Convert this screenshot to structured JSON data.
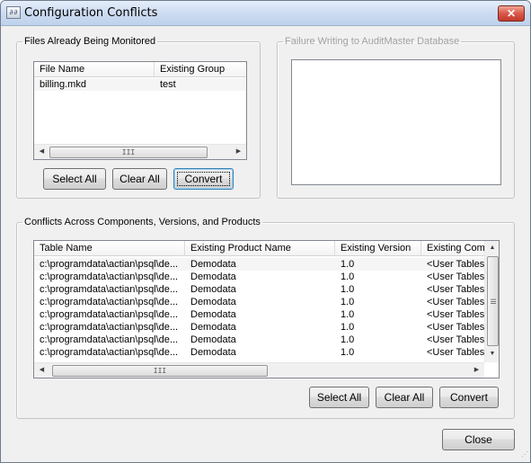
{
  "window": {
    "title": "Configuration Conflicts",
    "icon_text": "∂∂",
    "close_glyph": "✕"
  },
  "monitored": {
    "legend": "Files Already Being Monitored",
    "columns": [
      "File Name",
      "Existing Group"
    ],
    "rows": [
      [
        "billing.mkd",
        "test"
      ]
    ],
    "buttons": {
      "select_all": "Select All",
      "clear_all": "Clear All",
      "convert": "Convert"
    }
  },
  "failure": {
    "legend": "Failure Writing to AuditMaster Database"
  },
  "conflicts": {
    "legend": "Conflicts Across Components, Versions, and Products",
    "columns": [
      "Table Name",
      "Existing Product Name",
      "Existing Version",
      "Existing Comp"
    ],
    "rows": [
      [
        "c:\\programdata\\actian\\psql\\de...",
        "Demodata",
        "1.0",
        "<User Tables"
      ],
      [
        "c:\\programdata\\actian\\psql\\de...",
        "Demodata",
        "1.0",
        "<User Tables"
      ],
      [
        "c:\\programdata\\actian\\psql\\de...",
        "Demodata",
        "1.0",
        "<User Tables"
      ],
      [
        "c:\\programdata\\actian\\psql\\de...",
        "Demodata",
        "1.0",
        "<User Tables"
      ],
      [
        "c:\\programdata\\actian\\psql\\de...",
        "Demodata",
        "1.0",
        "<User Tables"
      ],
      [
        "c:\\programdata\\actian\\psql\\de...",
        "Demodata",
        "1.0",
        "<User Tables"
      ],
      [
        "c:\\programdata\\actian\\psql\\de...",
        "Demodata",
        "1.0",
        "<User Tables"
      ],
      [
        "c:\\programdata\\actian\\psql\\de...",
        "Demodata",
        "1.0",
        "<User Tables"
      ]
    ],
    "buttons": {
      "select_all": "Select All",
      "clear_all": "Clear All",
      "convert": "Convert"
    }
  },
  "footer": {
    "close": "Close"
  },
  "scroll_glyphs": {
    "left": "◀",
    "right": "▶",
    "up": "▲",
    "down": "▼",
    "grip": "III"
  }
}
